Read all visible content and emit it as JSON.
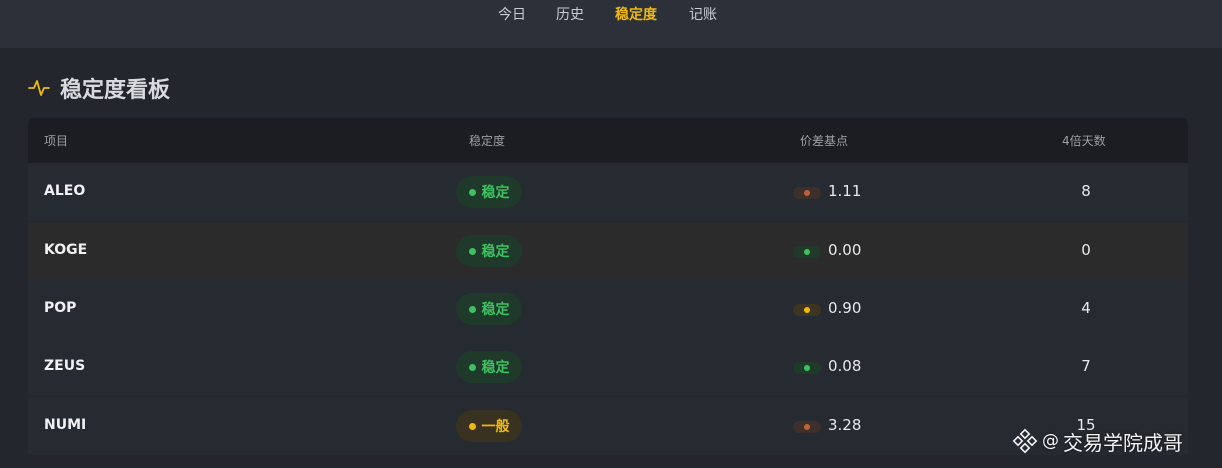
{
  "nav": {
    "tabs": [
      "今日",
      "历史",
      "稳定度",
      "记账"
    ],
    "active": "稳定度"
  },
  "board": {
    "title": "稳定度看板",
    "headers": {
      "project": "项目",
      "stability": "稳定度",
      "spread": "价差基点",
      "days": "4倍天数"
    },
    "rows": [
      {
        "name": "ALEO",
        "status": "稳定",
        "status_color": "green",
        "spread_color": "red",
        "spread": "1.11",
        "days": "8"
      },
      {
        "name": "KOGE",
        "status": "稳定",
        "status_color": "green",
        "spread_color": "green",
        "spread": "0.00",
        "days": "0"
      },
      {
        "name": "POP",
        "status": "稳定",
        "status_color": "green",
        "spread_color": "yellow",
        "spread": "0.90",
        "days": "4"
      },
      {
        "name": "ZEUS",
        "status": "稳定",
        "status_color": "green",
        "spread_color": "green",
        "spread": "0.08",
        "days": "7"
      },
      {
        "name": "NUMI",
        "status": "一般",
        "status_color": "yellow",
        "spread_color": "red",
        "spread": "3.28",
        "days": "15"
      }
    ]
  },
  "colors": {
    "accent": "#f0b90b",
    "green": "#3ec160",
    "red": "#c0603a",
    "background": "#23262d"
  },
  "watermark": {
    "at": "@",
    "name": "交易学院成哥"
  }
}
